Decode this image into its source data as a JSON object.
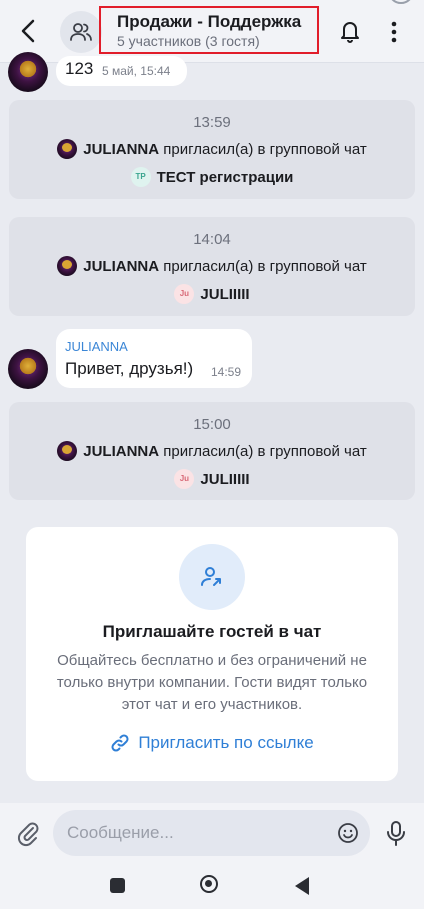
{
  "header": {
    "title": "Продажи - Поддержка",
    "subtitle": "5 участников (3 гостя)",
    "icons": [
      "back-arrow-icon",
      "group-users-icon",
      "bell-icon",
      "more-vertical-icon"
    ]
  },
  "messages": {
    "top_message": {
      "text": "123",
      "time": "5 май, 15:44"
    },
    "events": [
      {
        "time": "13:59",
        "actor": "JULIANNA",
        "action": "пригласил(а) в групповой чат",
        "target_initials": "ТР",
        "target_name": "ТЕСТ регистрации"
      },
      {
        "time": "14:04",
        "actor": "JULIANNA",
        "action": "пригласил(а) в групповой чат",
        "target_initials": "Ju",
        "target_name": "JULIIIII"
      },
      {
        "time": "15:00",
        "actor": "JULIANNA",
        "action": "пригласил(а) в групповой чат",
        "target_initials": "Ju",
        "target_name": "JULIIIII"
      }
    ],
    "greeting": {
      "sender": "JULIANNA",
      "text": "Привет, друзья!)",
      "time": "14:59"
    }
  },
  "invite": {
    "title": "Приглашайте гостей в чат",
    "description": "Общайтесь бесплатно и без ограничений не только внутри компании. Гости видят только этот чат и его участников.",
    "link_label": "Пригласить по ссылке"
  },
  "composer": {
    "placeholder": "Сообщение..."
  },
  "colors": {
    "accent": "#2f7fd6",
    "highlight_border": "#e11d2a",
    "sender_name": "#3b86d6"
  }
}
